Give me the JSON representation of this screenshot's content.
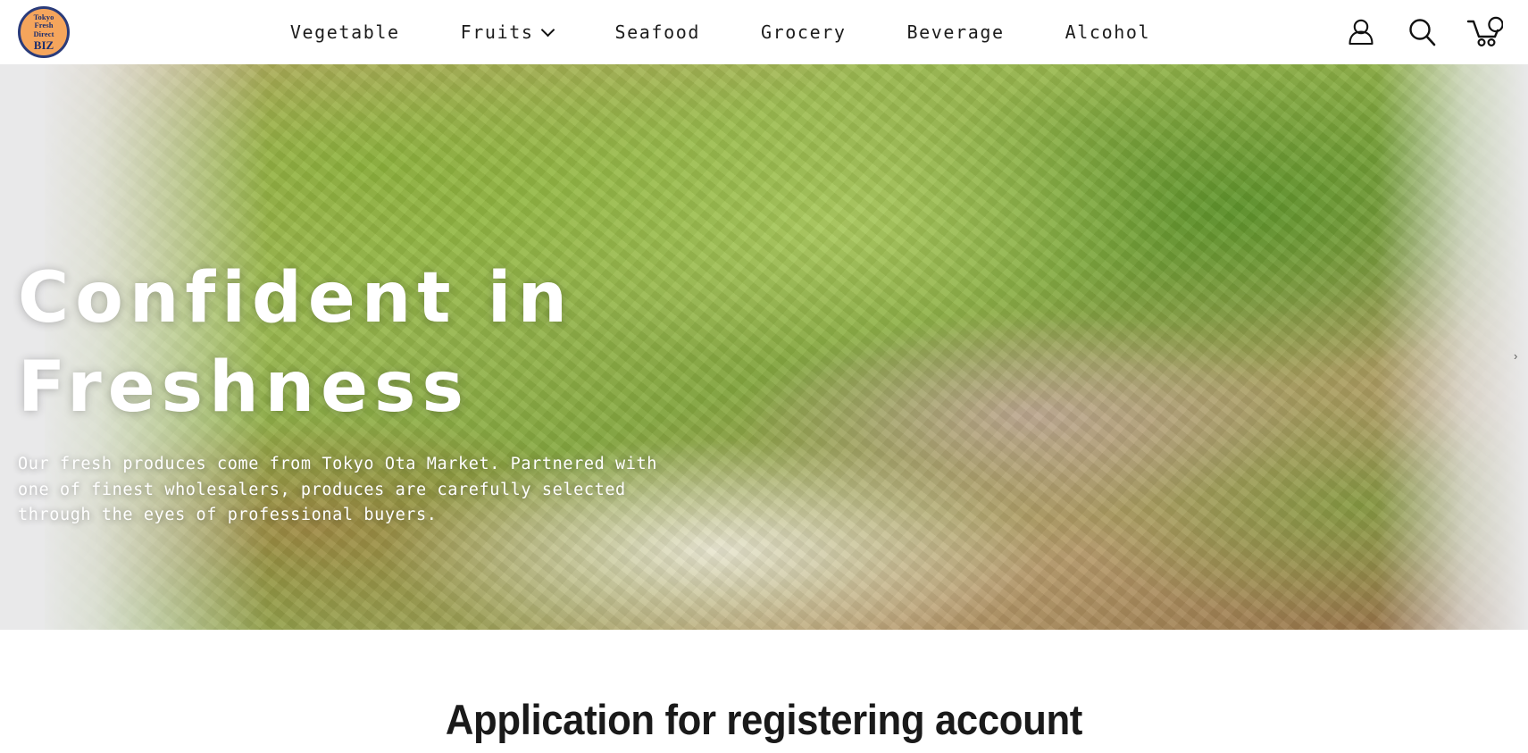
{
  "header": {
    "logo": {
      "line1": "Tokyo",
      "line2": "Fresh",
      "line3": "Direct",
      "line4": "BIZ",
      "background_color": "#f5a55c",
      "border_color": "#2a3b7a",
      "text_color": "#1e2f6e"
    },
    "nav": [
      {
        "label": "Vegetable",
        "has_dropdown": false
      },
      {
        "label": "Fruits",
        "has_dropdown": true
      },
      {
        "label": "Seafood",
        "has_dropdown": false
      },
      {
        "label": "Grocery",
        "has_dropdown": false
      },
      {
        "label": "Beverage",
        "has_dropdown": false
      },
      {
        "label": "Alcohol",
        "has_dropdown": false
      }
    ],
    "icons": {
      "account": "account-icon",
      "search": "search-icon",
      "cart": "cart-icon"
    }
  },
  "hero": {
    "title_line1": "Confident in",
    "title_line2": "Freshness",
    "paragraph_line1": "Our fresh produces come from Tokyo Ota Market. Partnered with",
    "paragraph_line2": "one of finest wholesalers, produces are carefully selected",
    "paragraph_line3": "through the eyes of professional buyers.",
    "background_color": "#e8e8e9",
    "text_color": "#ffffff",
    "carousel_next": "›"
  },
  "section": {
    "title": "Application for registering account"
  }
}
